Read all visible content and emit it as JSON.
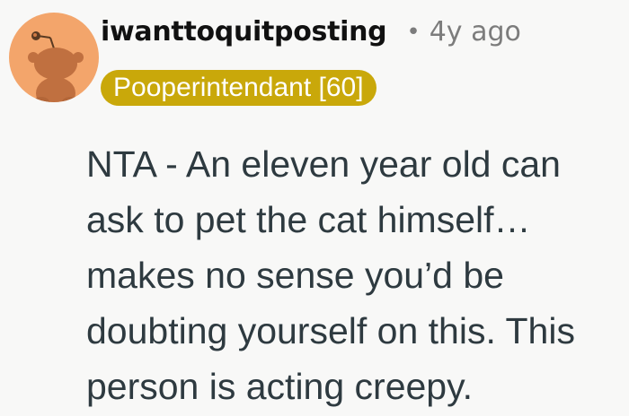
{
  "comment": {
    "username": "iwanttoquitposting",
    "separator": "•",
    "timestamp": "4y ago",
    "flair": "Pooperintendant [60]",
    "text": "NTA - An eleven year old can\nask to pet the cat himself…\nmakes no sense you’d be\ndoubting yourself on this. This\nperson is acting creepy."
  },
  "icons": {
    "avatar": "snoo-avatar-icon"
  },
  "colors": {
    "avatar_bg": "#f3a56b",
    "flair_bg": "#c9a80a",
    "flair_text": "#ffffff",
    "username": "#111111",
    "meta": "#7c7c7c",
    "body_text": "#2e3a40",
    "page_bg": "#f8f8f7"
  }
}
